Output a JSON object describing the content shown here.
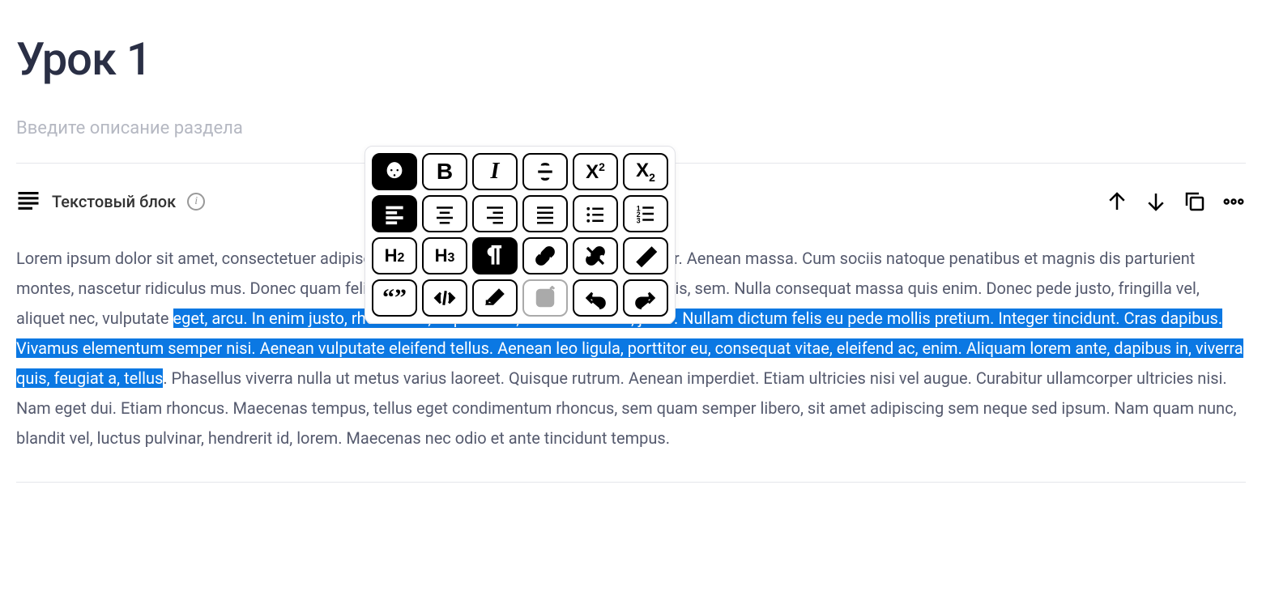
{
  "title": "Урок 1",
  "description_placeholder": "Введите описание раздела",
  "block": {
    "type_label": "Текстовый блок",
    "content_parts": {
      "before": "Lorem ipsum dolor sit amet, consectetuer adipiscing elit. Aenean commodo ligula eget dolor. Aenean massa. Cum sociis natoque penatibus et magnis dis parturient montes, nascetur ridiculus mus. Donec quam felis, ultricies nec, pellentesque eu, pretium quis, sem. Nulla consequat massa quis enim. Donec pede justo, fringilla vel, aliquet nec, vulputate ",
      "selected": "eget, arcu. In enim justo, rhoncus ut, imperdiet a, venenatis vitae, justo. Nullam dictum felis eu pede mollis pretium. Integer tincidunt. Cras dapibus. Vivamus elementum semper nisi. Aenean vulputate eleifend tellus. Aenean leo ligula, porttitor eu, consequat vitae, eleifend ac, enim. Aliquam lorem ante, dapibus in, viverra quis, feugiat a, tellus",
      "after": ". Phasellus viverra nulla ut metus varius laoreet. Quisque rutrum. Aenean imperdiet. Etiam ultricies nisi vel augue. Curabitur ullamcorper ultricies nisi. Nam eget dui. Etiam rhoncus. Maecenas tempus, tellus eget condimentum rhoncus, sem quam semper libero, sit amet adipiscing sem neque sed ipsum. Nam quam nunc, blandit vel, luctus pulvinar, hendrerit id, lorem. Maecenas nec odio et ante tincidunt tempus."
    }
  },
  "toolbar": {
    "row1": [
      "color",
      "bold",
      "italic",
      "strikethrough",
      "superscript",
      "subscript"
    ],
    "row2": [
      "align-left",
      "align-center",
      "align-right",
      "align-justify",
      "list-bullet",
      "list-number"
    ],
    "row3": [
      "h2",
      "h3",
      "paragraph",
      "link",
      "unlink",
      "clear-format"
    ],
    "row4": [
      "quote",
      "code",
      "erase",
      "insert",
      "undo",
      "redo"
    ],
    "labels": {
      "h2": "H2",
      "h3": "H3",
      "bold": "B",
      "italic": "I",
      "sup_base": "X",
      "sub_base": "X"
    },
    "active": [
      "color",
      "align-left",
      "paragraph"
    ]
  }
}
